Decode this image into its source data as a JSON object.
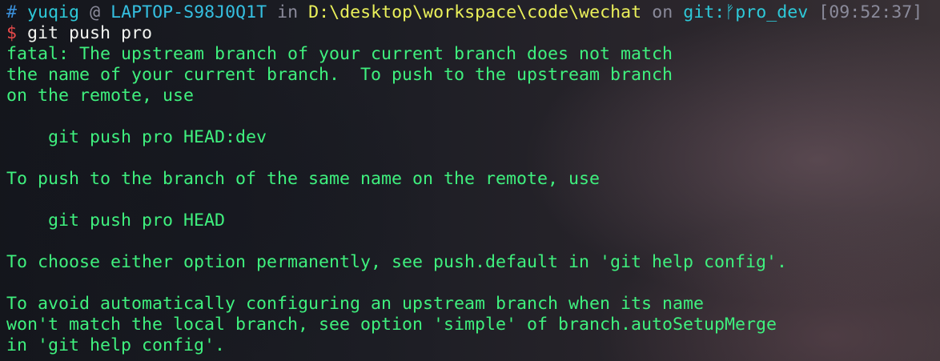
{
  "prompt": {
    "hash": "#",
    "user": "yuqig",
    "at": "@",
    "host": "LAPTOP-S98J0Q1T",
    "in": "in",
    "path": "D:\\desktop\\workspace\\code\\wechat",
    "on": "on",
    "git_label": "git:",
    "branch_glyph": "ᚠ",
    "branch": "pro_dev",
    "time": "[09:52:37]"
  },
  "command": {
    "dollar": "$",
    "text": "git push pro"
  },
  "output": {
    "lines": [
      "fatal: The upstream branch of your current branch does not match",
      "the name of your current branch.  To push to the upstream branch",
      "on the remote, use",
      "",
      "    git push pro HEAD:dev",
      "",
      "To push to the branch of the same name on the remote, use",
      "",
      "    git push pro HEAD",
      "",
      "To choose either option permanently, see push.default in 'git help config'.",
      "",
      "To avoid automatically configuring an upstream branch when its name",
      "won't match the local branch, see option 'simple' of branch.autoSetupMerge",
      "in 'git help config'."
    ]
  },
  "colors": {
    "output_green": "#3ff07e",
    "path_yellow": "#eaf05a",
    "user_cyan": "#2ec9d8",
    "dollar_red": "#e84a4a",
    "dim_gray": "#8a8a9a"
  }
}
